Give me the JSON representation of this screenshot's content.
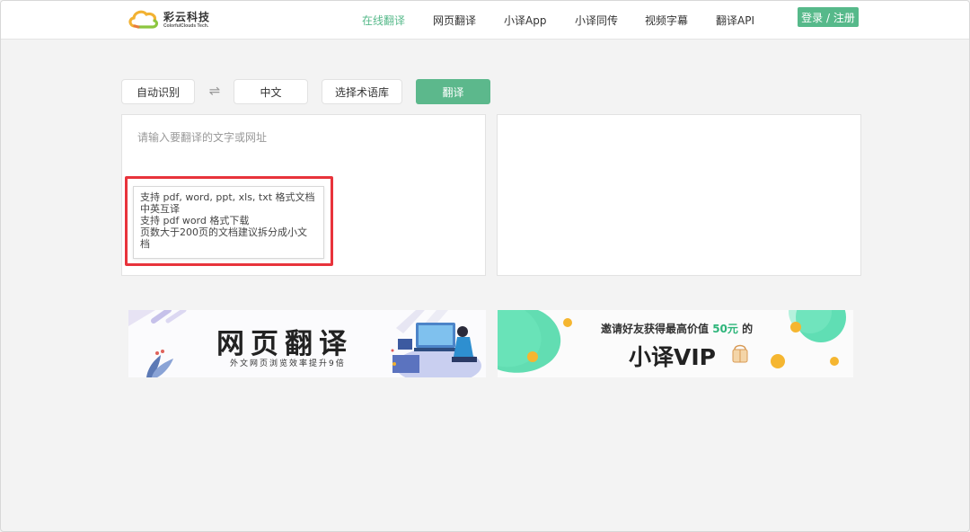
{
  "header": {
    "logo_name": "彩云科技",
    "logo_sub": "ColorfulClouds Tech.",
    "nav": [
      {
        "label": "在线翻译",
        "active": true
      },
      {
        "label": "网页翻译",
        "active": false
      },
      {
        "label": "小译App",
        "active": false
      },
      {
        "label": "小译同传",
        "active": false
      },
      {
        "label": "视频字幕",
        "active": false
      },
      {
        "label": "翻译API",
        "active": false
      }
    ],
    "login_label": "登录 / 注册"
  },
  "controls": {
    "source_lang": "自动识别",
    "swap_icon": "⇌",
    "target_lang": "中文",
    "glossary": "选择术语库",
    "translate": "翻译"
  },
  "input": {
    "placeholder": "请输入要翻译的文字或网址"
  },
  "tooltip": {
    "lines": [
      "支持 pdf, word, ppt, xls, txt 格式文档",
      "中英互译",
      "支持 pdf word 格式下载",
      "页数大于200页的文档建议拆分成小文",
      "档"
    ]
  },
  "banners": {
    "left": {
      "title": "网页翻译",
      "subtitle": "外文网页浏览效率提升9倍"
    },
    "right": {
      "prefix": "邀请好友获得最高价值 ",
      "amount": "50元",
      "suffix": " 的",
      "title": "小译VIP"
    }
  },
  "colors": {
    "accent": "#56b98a",
    "highlight_box": "#e8333b"
  }
}
